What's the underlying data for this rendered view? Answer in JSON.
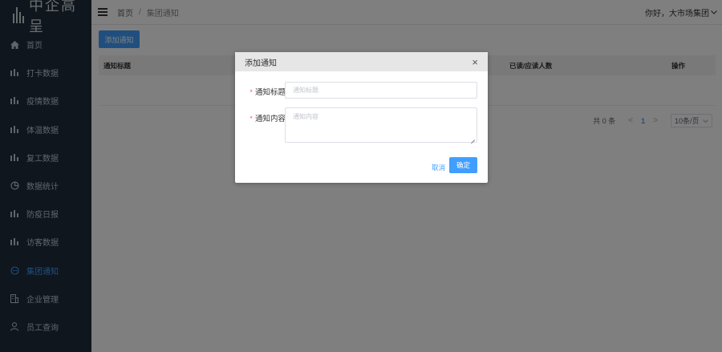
{
  "app": {
    "logo_text": "中企高呈"
  },
  "sidebar": {
    "items": [
      {
        "label": "首页",
        "icon": "home-icon"
      },
      {
        "label": "打卡数据",
        "icon": "bar-chart-icon"
      },
      {
        "label": "疫情数据",
        "icon": "bar-chart-icon"
      },
      {
        "label": "体温数据",
        "icon": "bar-chart-icon"
      },
      {
        "label": "复工数据",
        "icon": "bar-chart-icon"
      },
      {
        "label": "数据统计",
        "icon": "pie-chart-icon"
      },
      {
        "label": "防疫日报",
        "icon": "bar-chart-icon"
      },
      {
        "label": "访客数据",
        "icon": "bar-chart-icon"
      },
      {
        "label": "集团通知",
        "icon": "chat-bubble-icon",
        "active": true
      },
      {
        "label": "企业管理",
        "icon": "building-icon"
      },
      {
        "label": "员工查询",
        "icon": "user-icon"
      }
    ],
    "active_color": "#409eff"
  },
  "header": {
    "breadcrumb": {
      "home": "首页",
      "separator": "/",
      "current": "集团通知"
    },
    "user_greeting": "你好，大市场集团"
  },
  "main": {
    "add_button": "添加通知",
    "table": {
      "columns": [
        "通知标题",
        "已读/应读人数",
        "操作"
      ]
    },
    "pagination": {
      "total": "共 0 条",
      "prev": "<",
      "current_page": "1",
      "next": ">",
      "page_size": "10条/页"
    }
  },
  "dialog": {
    "title": "添加通知",
    "close": "×",
    "fields": {
      "title_label": "通知标题",
      "title_placeholder": "通知标题",
      "content_label": "通知内容",
      "content_placeholder": "通知内容",
      "required_mark": "*"
    },
    "cancel": "取消",
    "confirm": "确定"
  },
  "colors": {
    "primary": "#409eff",
    "sidebar_bg": "#1f2d3d",
    "required": "#f56c6c"
  }
}
